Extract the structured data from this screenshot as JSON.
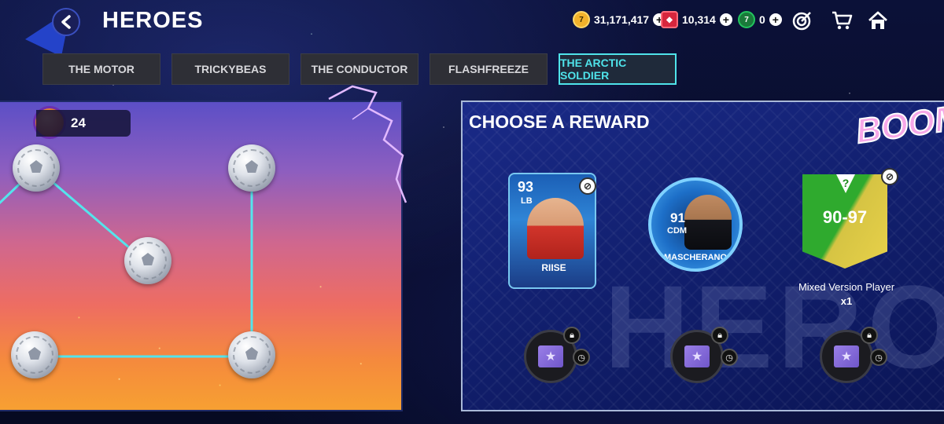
{
  "header": {
    "title": "HEROES",
    "currencies": [
      {
        "name": "coins",
        "value": "31,171,417",
        "color": "#f2b22b"
      },
      {
        "name": "points",
        "value": "10,314",
        "color": "#d7263d"
      },
      {
        "name": "tokens",
        "value": "0",
        "color": "#22c55e"
      }
    ],
    "icons": [
      "target-icon",
      "cart-icon",
      "home-icon"
    ]
  },
  "tabs": [
    {
      "label": "THE MOTOR",
      "active": false
    },
    {
      "label": "TRICKYBEAS",
      "active": false
    },
    {
      "label": "THE CONDUCTOR",
      "active": false
    },
    {
      "label": "FLASHFREEZE",
      "active": false
    },
    {
      "label": "THE ARCTIC SOLDIER",
      "active": true
    }
  ],
  "board": {
    "token_count": "24"
  },
  "reward": {
    "title": "CHOOSE A REWARD",
    "sticker": "BOOM",
    "options": [
      {
        "rating": "93",
        "position": "LB",
        "name": "RIISE"
      },
      {
        "rating": "91",
        "position": "CDM",
        "name": "MASCHERANO"
      },
      {
        "range": "90-97",
        "label": "Mixed Version Player",
        "quantity": "x1"
      }
    ]
  },
  "colors": {
    "accent_tab": "#4fe3ea",
    "path_line": "#54e4ec"
  }
}
